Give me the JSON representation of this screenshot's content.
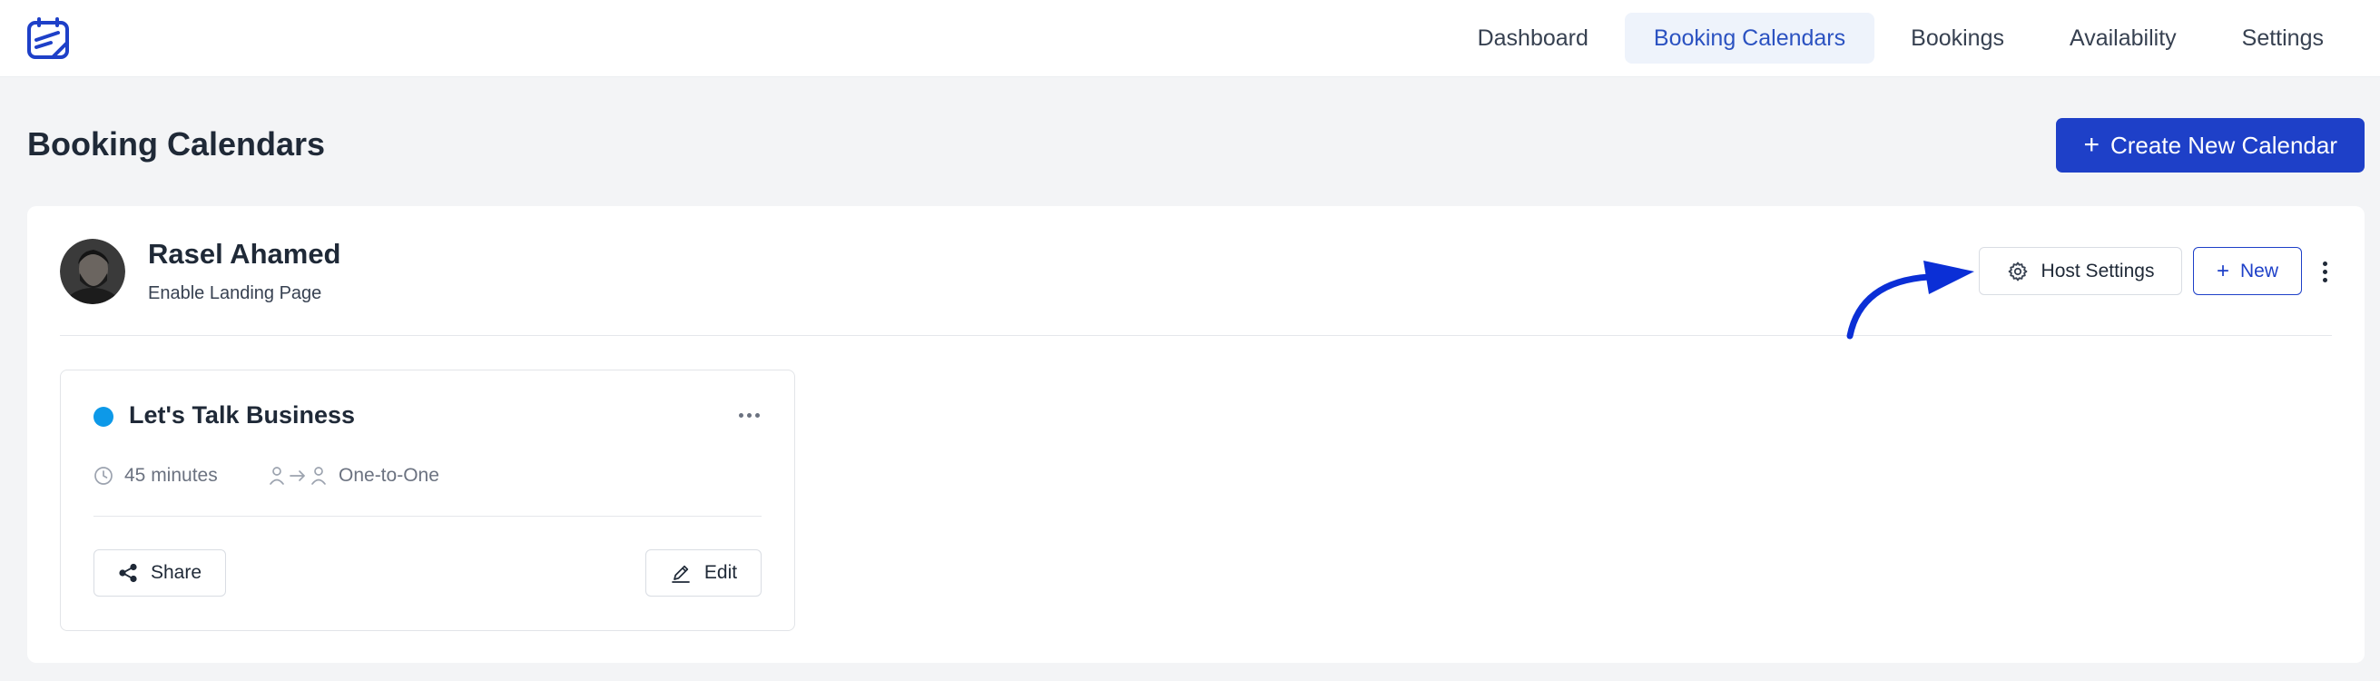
{
  "nav": {
    "items": [
      {
        "label": "Dashboard",
        "active": false
      },
      {
        "label": "Booking Calendars",
        "active": true
      },
      {
        "label": "Bookings",
        "active": false
      },
      {
        "label": "Availability",
        "active": false
      },
      {
        "label": "Settings",
        "active": false
      }
    ]
  },
  "page": {
    "title": "Booking Calendars",
    "create_button": "Create New Calendar"
  },
  "host": {
    "name": "Rasel Ahamed",
    "subtitle": "Enable Landing Page",
    "settings_button": "Host Settings",
    "new_button": "New"
  },
  "event": {
    "title": "Let's Talk Business",
    "duration": "45 minutes",
    "type": "One-to-One",
    "share_button": "Share",
    "edit_button": "Edit",
    "dot_color": "#0d99e8"
  },
  "colors": {
    "brand": "#1e40c8",
    "active_nav_bg": "#eef3fb",
    "active_nav_text": "#2b52c1",
    "annotation_arrow": "#0b2fd6"
  },
  "icons": {
    "logo": "calendar-logo-icon",
    "create": "plus-icon",
    "host_settings": "gear-icon",
    "new": "plus-icon",
    "host_more": "vertical-dots-icon",
    "event_more": "horizontal-dots-icon",
    "duration": "clock-icon",
    "type": "user-arrow-user-icon",
    "share": "share-icon",
    "edit": "pencil-icon"
  }
}
